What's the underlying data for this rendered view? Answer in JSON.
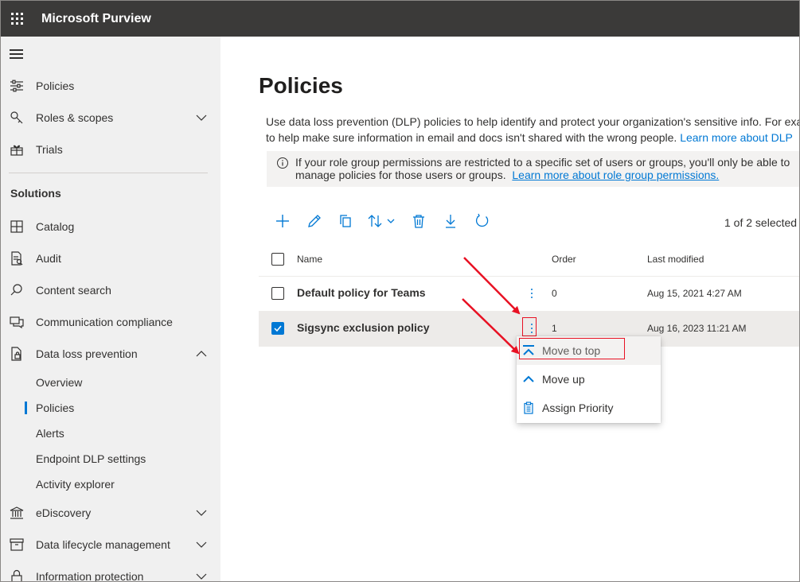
{
  "header": {
    "app_title": "Microsoft Purview"
  },
  "sidebar": {
    "top_items": [
      {
        "label": "Policies",
        "icon": "sliders-icon"
      },
      {
        "label": "Roles & scopes",
        "icon": "key-icon"
      },
      {
        "label": "Trials",
        "icon": "trials-icon"
      }
    ],
    "section_heading": "Solutions",
    "solutions": [
      {
        "label": "Catalog",
        "icon": "catalog-icon"
      },
      {
        "label": "Audit",
        "icon": "audit-icon"
      },
      {
        "label": "Content search",
        "icon": "search-icon"
      },
      {
        "label": "Communication compliance",
        "icon": "chat-icon"
      },
      {
        "label": "Data loss prevention",
        "icon": "dlp-icon"
      }
    ],
    "dlp_subitems": [
      {
        "label": "Overview"
      },
      {
        "label": "Policies"
      },
      {
        "label": "Alerts"
      },
      {
        "label": "Endpoint DLP settings"
      },
      {
        "label": "Activity explorer"
      }
    ],
    "more_items": [
      {
        "label": "eDiscovery",
        "icon": "ediscovery-icon"
      },
      {
        "label": "Data lifecycle management",
        "icon": "archive-icon"
      },
      {
        "label": "Information protection",
        "icon": "lock-icon"
      }
    ]
  },
  "main": {
    "title": "Policies",
    "description_line1": "Use data loss prevention (DLP) policies to help identify and protect your organization's sensitive info. For exa",
    "description_line2": "to help make sure information in email and docs isn't shared with the wrong people.",
    "description_link": "Learn more about DLP",
    "info_line1": "If your role group permissions are restricted to a specific set of users or groups, you'll only be able to",
    "info_line2": "manage policies for those users or groups.",
    "info_link": "Learn more about role group permissions.",
    "selected_count": "1 of 2 selected",
    "columns": {
      "name": "Name",
      "order": "Order",
      "last_modified": "Last modified"
    },
    "rows": [
      {
        "name": "Default policy for Teams",
        "order": "0",
        "last_modified": "Aug 15, 2021 4:27 AM",
        "checked": false
      },
      {
        "name": "Sigsync exclusion policy",
        "order": "1",
        "last_modified": "Aug 16, 2023 11:21 AM",
        "checked": true
      }
    ]
  },
  "context_menu": {
    "items": [
      {
        "label": "Move to top",
        "icon": "move-to-top-icon"
      },
      {
        "label": "Move up",
        "icon": "chevron-up-icon"
      },
      {
        "label": "Assign Priority",
        "icon": "clipboard-icon"
      }
    ]
  },
  "colors": {
    "accent": "#0078d4",
    "topbar": "#3b3a39",
    "sidebar": "#f0f0f0",
    "annotation": "#e81123"
  }
}
